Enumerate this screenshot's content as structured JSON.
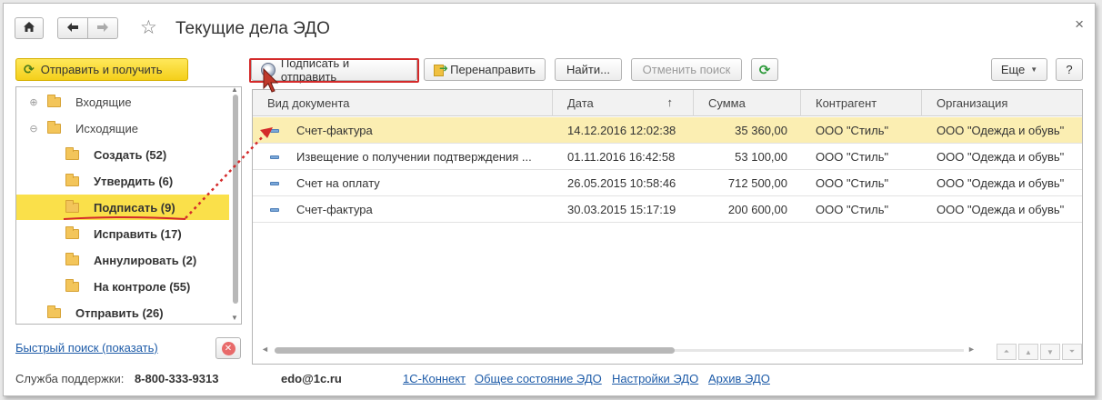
{
  "window": {
    "title": "Текущие дела ЭДО",
    "close_glyph": "×"
  },
  "titlebar": {
    "home_icon": "home-icon",
    "back_icon": "arrow-left-icon",
    "forward_icon": "arrow-right-icon",
    "favorite_icon": "star-icon"
  },
  "left_panel": {
    "send_receive_label": "Отправить и получить",
    "tree": [
      {
        "label": "Входящие",
        "expander": "⊕",
        "level": 1,
        "bold": false,
        "selected": false
      },
      {
        "label": "Исходящие",
        "expander": "⊖",
        "level": 1,
        "bold": false,
        "selected": false
      },
      {
        "label": "Создать (52)",
        "level": 2,
        "bold": true,
        "selected": false
      },
      {
        "label": "Утвердить (6)",
        "level": 2,
        "bold": true,
        "selected": false
      },
      {
        "label": "Подписать (9)",
        "level": 2,
        "bold": true,
        "selected": true
      },
      {
        "label": "Исправить (17)",
        "level": 2,
        "bold": true,
        "selected": false
      },
      {
        "label": "Аннулировать (2)",
        "level": 2,
        "bold": true,
        "selected": false
      },
      {
        "label": "На контроле (55)",
        "level": 2,
        "bold": true,
        "selected": false
      },
      {
        "label": "Отправить (26)",
        "level": 1,
        "bold": true,
        "selected": false
      }
    ],
    "quick_search_label": "Быстрый поиск (показать)"
  },
  "toolbar": {
    "sign_send_label": "Подписать и отправить",
    "redirect_label": "Перенаправить",
    "find_label": "Найти...",
    "cancel_search_label": "Отменить поиск",
    "more_label": "Еще",
    "help_label": "?"
  },
  "table": {
    "columns": [
      "Вид документа",
      "Дата",
      "Сумма",
      "Контрагент",
      "Организация"
    ],
    "sort_indicator": "↑",
    "rows": [
      {
        "doc_type": "Счет-фактура",
        "date": "14.12.2016 12:02:38",
        "amount": "35 360,00",
        "counterparty": "ООО \"Стиль\"",
        "organization": "ООО \"Одежда и обувь\"",
        "selected": true
      },
      {
        "doc_type": "Извещение о получении подтверждения ...",
        "date": "01.11.2016 16:42:58",
        "amount": "53 100,00",
        "counterparty": "ООО \"Стиль\"",
        "organization": "ООО \"Одежда и обувь\"",
        "selected": false
      },
      {
        "doc_type": "Счет на оплату",
        "date": "26.05.2015 10:58:46",
        "amount": "712 500,00",
        "counterparty": "ООО \"Стиль\"",
        "organization": "ООО \"Одежда и обувь\"",
        "selected": false
      },
      {
        "doc_type": "Счет-фактура",
        "date": "30.03.2015 15:17:19",
        "amount": "200 600,00",
        "counterparty": "ООО \"Стиль\"",
        "organization": "ООО \"Одежда и обувь\"",
        "selected": false
      }
    ]
  },
  "footer": {
    "support_label": "Служба поддержки:",
    "phone": "8-800-333-9313",
    "email": "edo@1c.ru",
    "links": [
      "1С-Коннект",
      "Общее состояние ЭДО",
      "Настройки ЭДО",
      "Архив ЭДО"
    ]
  },
  "colors": {
    "accent_yellow": "#fae04a",
    "selected_row": "#fbeeb2",
    "highlight_red": "#d42a2a",
    "link_blue": "#1d5ba8"
  }
}
